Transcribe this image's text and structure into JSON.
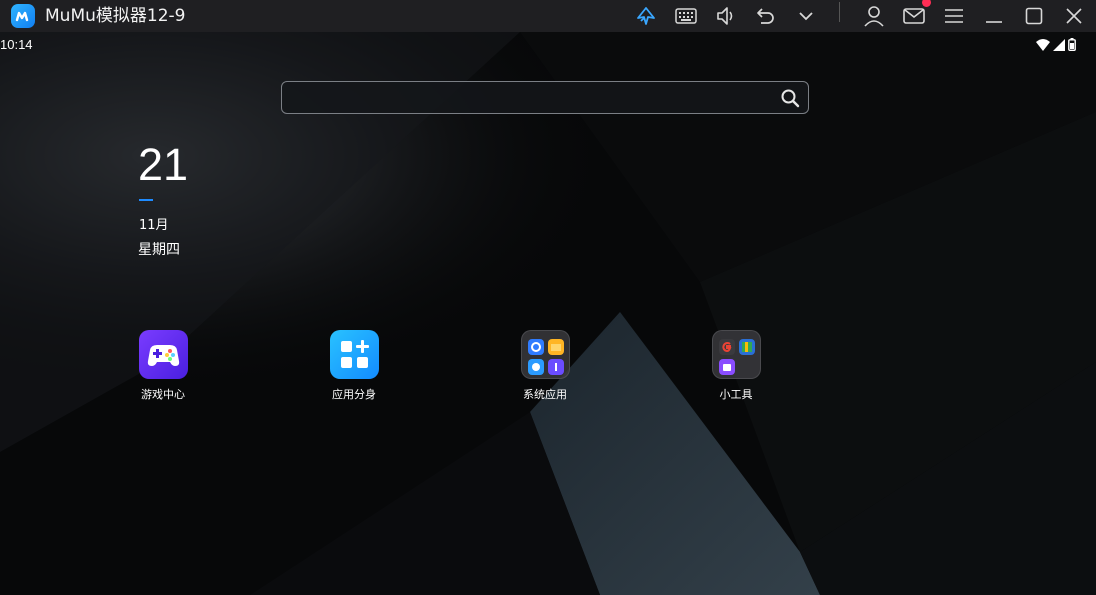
{
  "window": {
    "title": "MuMu模拟器12-9",
    "toolbar_icons": [
      "vpn-rocket-icon",
      "keyboard-icon",
      "volume-icon",
      "back-icon",
      "more-chevron-icon",
      "user-icon",
      "mail-icon",
      "menu-icon",
      "minimize-icon",
      "maximize-icon",
      "close-icon"
    ],
    "accent": "#1e8bff"
  },
  "statusbar": {
    "time": "10:14"
  },
  "search": {
    "value": "",
    "placeholder": ""
  },
  "clock": {
    "day": "21",
    "month": "11月",
    "weekday": "星期四"
  },
  "apps": [
    {
      "label": "游戏中心",
      "icon": "gamepad-icon"
    },
    {
      "label": "应用分身",
      "icon": "app-clone-icon"
    },
    {
      "label": "系统应用",
      "icon": "folder-icon"
    },
    {
      "label": "小工具",
      "icon": "folder-icon"
    }
  ]
}
